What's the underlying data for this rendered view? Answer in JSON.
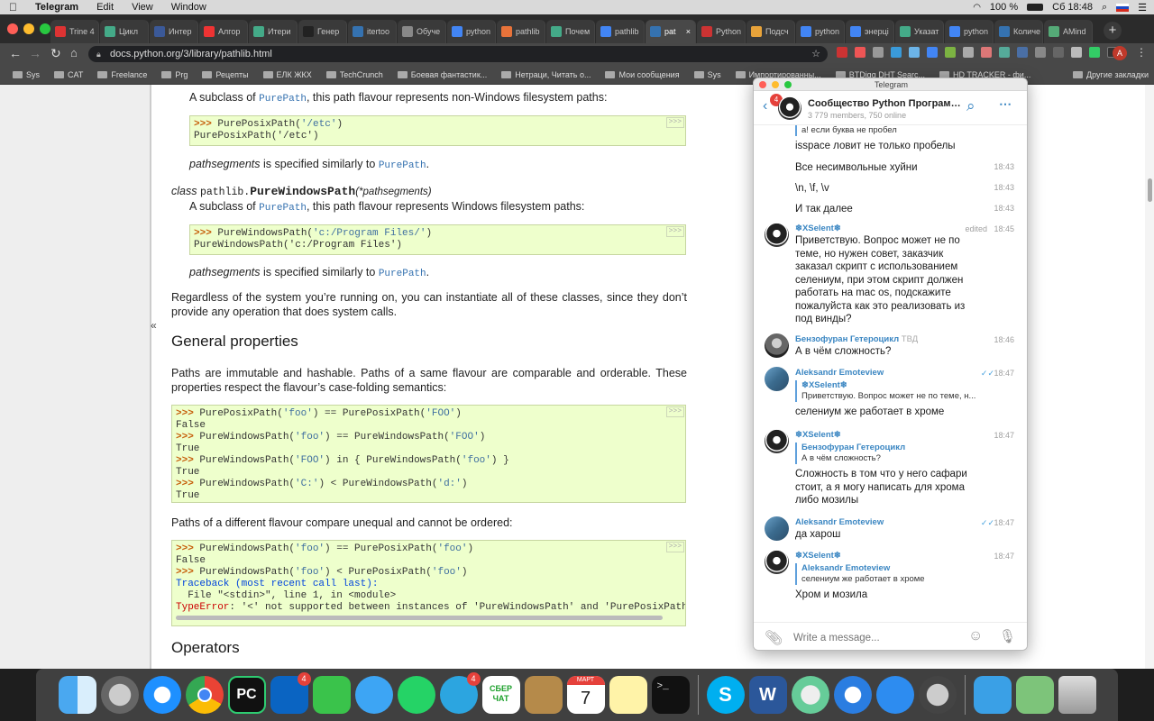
{
  "menubar": {
    "app": "Telegram",
    "items": [
      "Edit",
      "View",
      "Window"
    ],
    "battery": "100 %",
    "clock": "Сб 18:48"
  },
  "browser": {
    "tabs": [
      {
        "label": "Trine 4",
        "color": "#d33"
      },
      {
        "label": "Цикл",
        "color": "#4a8"
      },
      {
        "label": "Интер",
        "color": "#3b5998"
      },
      {
        "label": "Алгор",
        "color": "#e33"
      },
      {
        "label": "Итери",
        "color": "#4a8"
      },
      {
        "label": "Генер",
        "color": "#222"
      },
      {
        "label": "itertoo",
        "color": "#3572b0"
      },
      {
        "label": "Обуче",
        "color": "#888"
      },
      {
        "label": "python",
        "color": "#4285f4"
      },
      {
        "label": "pathlib",
        "color": "#e8733a"
      },
      {
        "label": "Почем",
        "color": "#4a8"
      },
      {
        "label": "pathlib",
        "color": "#4285f4"
      },
      {
        "label": "pat",
        "color": "#3572b0",
        "active": true
      },
      {
        "label": "Python",
        "color": "#c33"
      },
      {
        "label": "Подсч",
        "color": "#e8a33a"
      },
      {
        "label": "python",
        "color": "#4285f4"
      },
      {
        "label": "энерці",
        "color": "#4285f4"
      },
      {
        "label": "Указат",
        "color": "#4a8"
      },
      {
        "label": "python",
        "color": "#4285f4"
      },
      {
        "label": "Количе",
        "color": "#3572b0"
      },
      {
        "label": "AMind",
        "color": "#5a7"
      }
    ],
    "url": "docs.python.org/3/library/pathlib.html",
    "bookmarks": [
      "Sys",
      "CAT",
      "Freelance",
      "Prg",
      "Рецепты",
      "ЕЛК ЖКХ",
      "TechCrunch",
      "Боевая фантастик...",
      "Нетраци, Читать о...",
      "Мои сообщения",
      "Sys",
      "Импортированны...",
      "BTDigg DHT Searc...",
      "HD TRACKER - фи...",
      "Другие закладки"
    ]
  },
  "doc": {
    "p1": "A subclass of PurePath, this path flavour represents non-Windows filesystem paths:",
    "p1_prefix": "A subclass of ",
    "p1_link": "PurePath",
    "p1_suffix": ", this path flavour represents non-Windows filesystem paths:",
    "code1_l1_prompt": ">>> ",
    "code1_l1_a": "PurePosixPath(",
    "code1_l1_s": "'/etc'",
    "code1_l1_b": ")",
    "code1_l2": "PurePosixPath('/etc')",
    "seg1_em": "pathsegments",
    "seg1_mid": " is specified similarly to ",
    "seg1_link": "PurePath",
    "seg1_end": ".",
    "class_kw": "class",
    "class_mod": "pathlib.",
    "class_name": "PureWindowsPath",
    "class_args": "(*pathsegments)",
    "p2_prefix": "A subclass of ",
    "p2_link": "PurePath",
    "p2_suffix": ", this path flavour represents Windows filesystem paths:",
    "code2_l1_prompt": ">>> ",
    "code2_l1_a": "PureWindowsPath(",
    "code2_l1_s": "'c:/Program Files/'",
    "code2_l1_b": ")",
    "code2_l2": "PureWindowsPath('c:/Program Files')",
    "seg2_em": "pathsegments",
    "seg2_mid": " is specified similarly to ",
    "seg2_link": "PurePath",
    "seg2_end": ".",
    "p3": "Regardless of the system you’re running on, you can instantiate all of these classes, since they don’t provide any operation that does system calls.",
    "h_general": "General properties",
    "p4": "Paths are immutable and hashable. Paths of a same flavour are comparable and orderable. These properties respect the flavour’s case-folding semantics:",
    "p5": "Paths of a different flavour compare unequal and cannot be ordered:",
    "h_operators": "Operators",
    "copy_label": ">>>",
    "collapse": "«"
  },
  "telegram": {
    "window_title": "Telegram",
    "chat_name": "Сообщество Python Программ...",
    "chat_sub": "3 779 members, 750 online",
    "back_badge": "4",
    "input_placeholder": "Write a message...",
    "messages": {
      "m0_reply": "а! если буква не пробел",
      "m0_text": "isspace ловит не только пробелы",
      "m1_text": "Все несимвольные хуйни",
      "m1_time": "18:43",
      "m2_text": "\\n, \\f, \\v",
      "m2_time": "18:43",
      "m3_text": "И так далее",
      "m3_time": "18:43",
      "m4_sender": "❄XSelent❄",
      "m4_edited": "edited",
      "m4_time": "18:45",
      "m4_text": "Приветствую. Вопрос может не по теме, но нужен совет, заказчик заказал скрипт с использованием селениум, при этом скрипт должен работать на mac os, подскажите пожалуйста как это реализовать из под винды?",
      "m5_sender": "Бензофуран Гетероцикл",
      "m5_tag": "ТВД",
      "m5_time": "18:46",
      "m5_text": "А в чём сложность?",
      "m6_sender": "Aleksandr Emoteview",
      "m6_time": "18:47",
      "m6_reply_name": "❄XSelent❄",
      "m6_reply_text": "Приветствую. Вопрос может не по теме, н...",
      "m6_text": "селениум же работает в хроме",
      "m7_sender": "❄XSelent❄",
      "m7_time": "18:47",
      "m7_reply_name": "Бензофуран Гетероцикл",
      "m7_reply_text": "А в чём сложность?",
      "m7_text": "Сложность в том что у него сафари стоит, а я могу написать для хрома либо мозилы",
      "m8_sender": "Aleksandr Emoteview",
      "m8_time": "18:47",
      "m8_text": "да харош",
      "m9_sender": "❄XSelent❄",
      "m9_time": "18:47",
      "m9_reply_name": "Aleksandr Emoteview",
      "m9_reply_text": "селениум же работает в хроме",
      "m9_text": "Хром и мозила"
    }
  },
  "dock": {
    "outlook_badge": "4",
    "telegram_badge": "4",
    "calendar_month": "МАРТ",
    "calendar_day": "7",
    "sber_label": "СБЕР ЧАТ"
  }
}
